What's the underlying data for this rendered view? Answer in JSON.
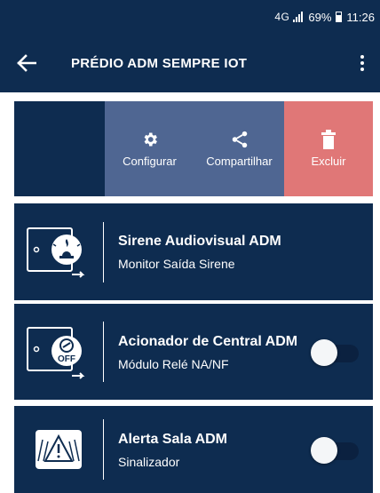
{
  "status_bar": {
    "network": "4G",
    "battery": "69%",
    "time": "11:26"
  },
  "header": {
    "title": "PRÉDIO ADM SEMPRE IOT",
    "back_icon": "arrow-left-icon",
    "menu_icon": "more-vert-icon"
  },
  "swipe_actions": [
    {
      "label": "Configurar",
      "icon": "gear-icon",
      "color": "#4f6692"
    },
    {
      "label": "Compartilhar",
      "icon": "share-icon",
      "color": "#4f6692"
    },
    {
      "label": "Excluir",
      "icon": "trash-icon",
      "color": "#e07777"
    }
  ],
  "devices": [
    {
      "name": "Sirene Audiovisual ADM",
      "subtitle": "Monitor Saída Sirene",
      "icon": "siren-device-icon"
    },
    {
      "name": "Acionador de Central ADM",
      "subtitle": "Módulo Relé NA/NF",
      "icon": "relay-off-device-icon",
      "toggle_on": false
    },
    {
      "name": "Alerta Sala ADM",
      "subtitle": "Sinalizador",
      "icon": "warning-signal-icon",
      "toggle_on": false
    }
  ],
  "colors": {
    "primary": "#0e2c50",
    "action": "#4f6692",
    "danger": "#e07777"
  }
}
